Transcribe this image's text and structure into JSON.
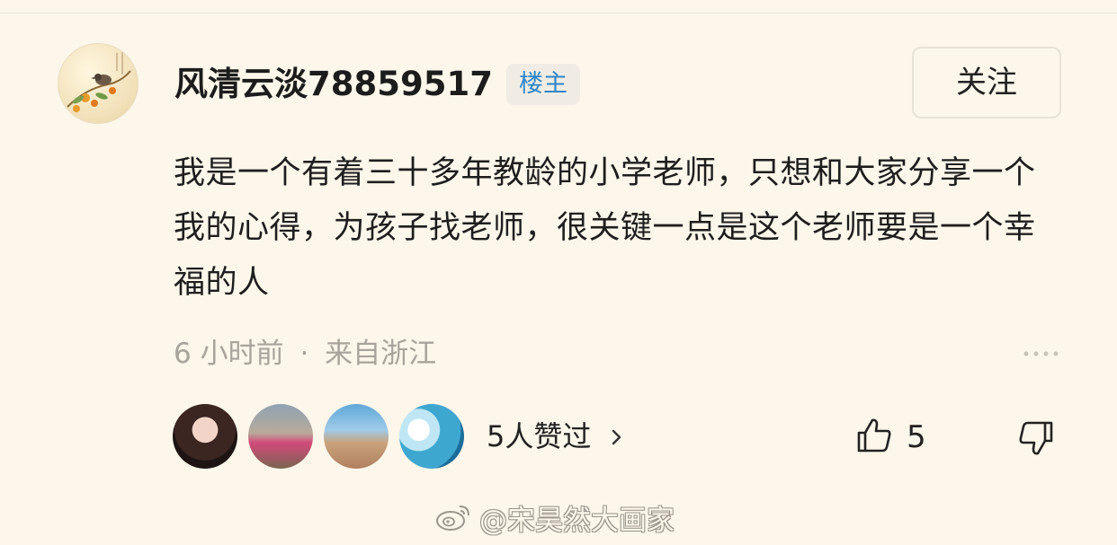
{
  "comment": {
    "author": "风清云淡78859517",
    "badge": "楼主",
    "follow_label": "关注",
    "text": "我是一个有着三十多年教龄的小学老师，只想和大家分享一个我的心得，为孩子找老师，很关键一点是这个老师要是一个幸福的人",
    "time": "6 小时前",
    "separator": "·",
    "location": "来自浙江",
    "likers_summary": "5人赞过",
    "like_count": "5"
  },
  "icons": {
    "avatar": "bird-painting-avatar",
    "more": "more-dots-icon",
    "chevron": "chevron-right-icon",
    "like": "thumb-up-icon",
    "dislike": "thumb-down-icon",
    "watermark_logo": "weibo-logo-icon"
  },
  "watermark": "@宋昊然大画家",
  "colors": {
    "background": "#fdf6ea",
    "badge_text": "#2e86c9",
    "meta_text": "#a8a39b"
  }
}
